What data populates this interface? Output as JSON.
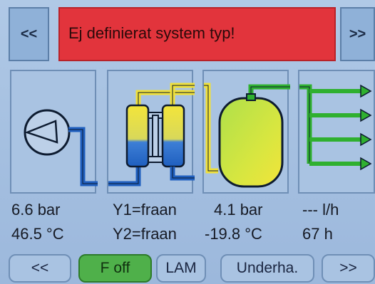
{
  "header": {
    "prev_label": "<<",
    "title": "Ej definierat system typ!",
    "next_label": ">>"
  },
  "panels": [
    {
      "name": "compressor",
      "icon": "compressor-icon"
    },
    {
      "name": "dryer",
      "icon": "dryer-icon"
    },
    {
      "name": "tank",
      "icon": "tank-icon"
    },
    {
      "name": "outlet",
      "icon": "outlet-manifold-icon"
    }
  ],
  "readings": {
    "compressor_pressure": "6.6 bar",
    "compressor_temp": "46.5 °C",
    "dryer_y1": "Y1=fraan",
    "dryer_y2": "Y2=fraan",
    "tank_pressure": "4.1 bar",
    "tank_temp": "-19.8 °C",
    "flow": "--- l/h",
    "hours": "67 h"
  },
  "footer": {
    "prev_label": "<<",
    "foff_label": "F off",
    "lam_label": "LAM",
    "underhall_label": "Underha.",
    "next_label": ">>"
  },
  "colors": {
    "background": "#a9c3e2",
    "alarm": "#e2343c",
    "active": "#4fb04a",
    "pipe_blue": "#1f5fbf",
    "pipe_yellow": "#f0e03a",
    "pipe_green": "#2fb02f"
  }
}
